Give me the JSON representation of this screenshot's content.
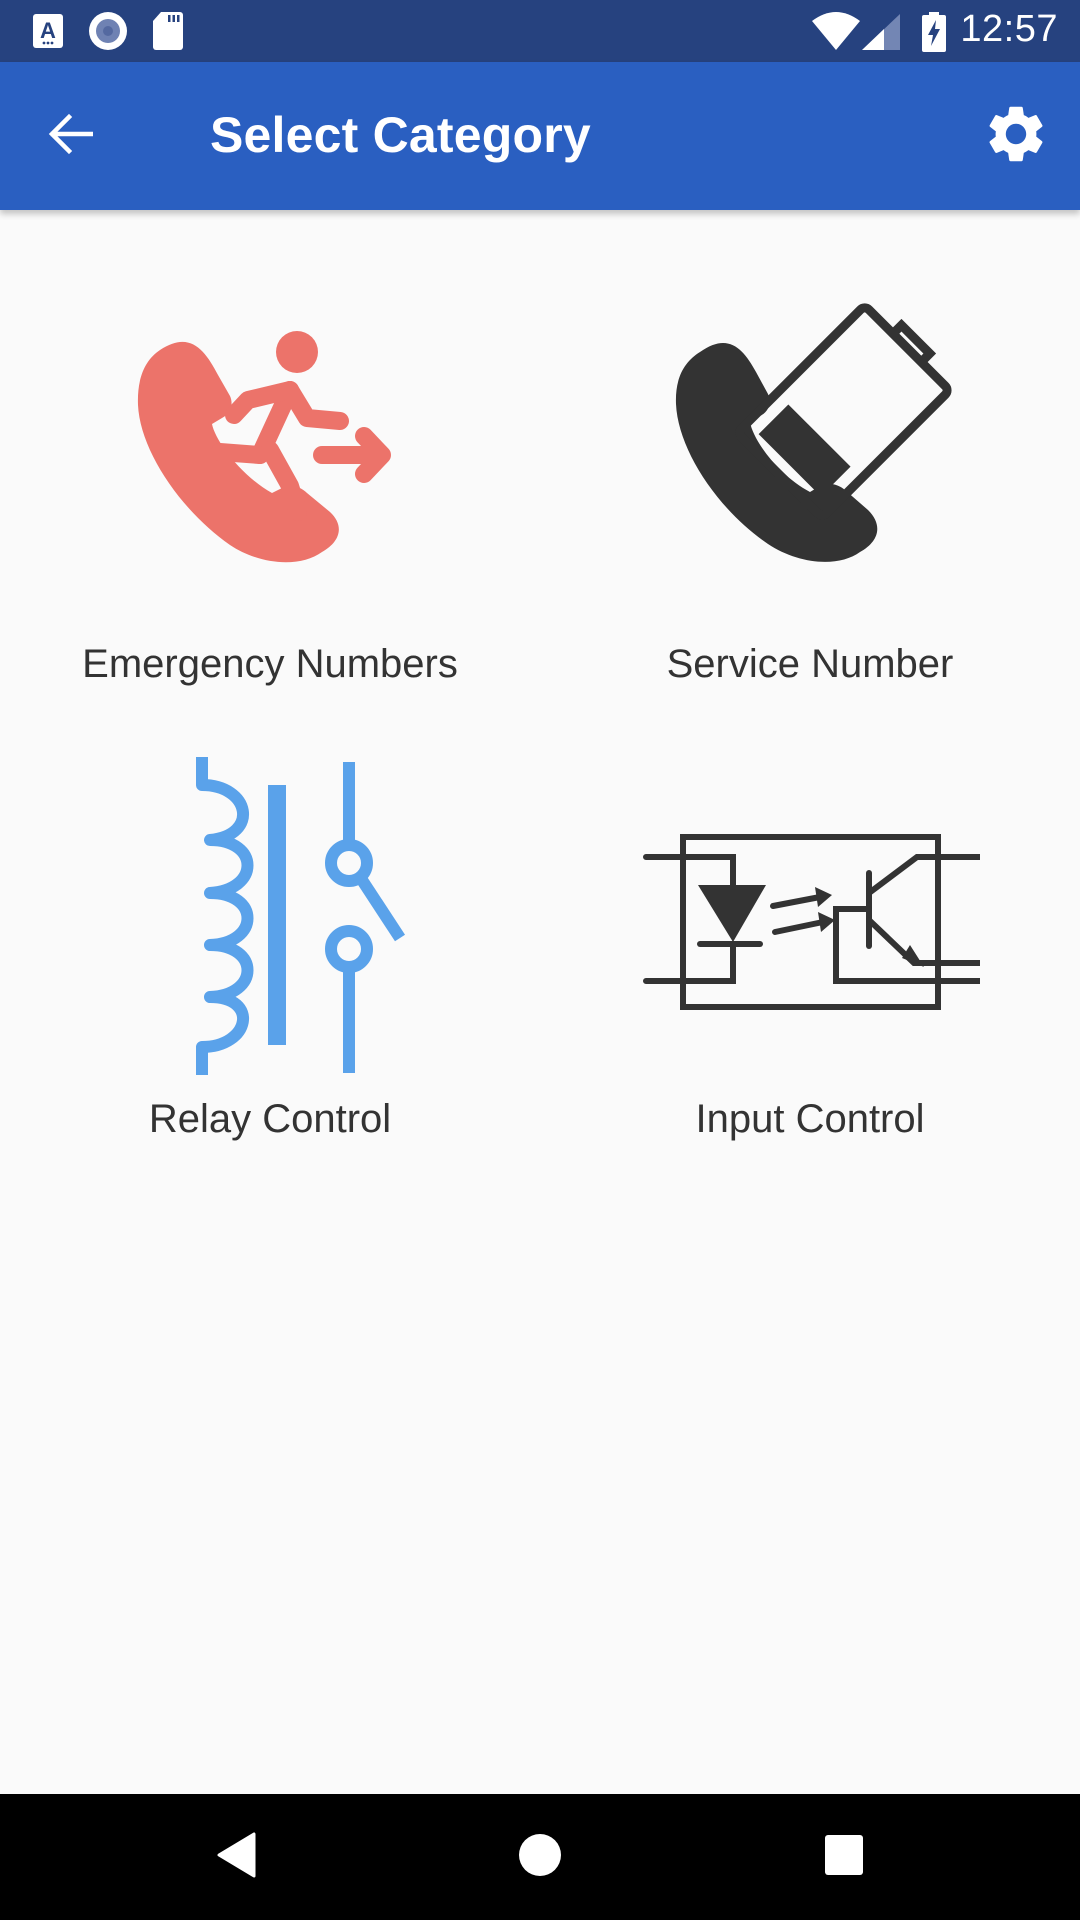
{
  "status_bar": {
    "time": "12:57",
    "left_icons": [
      "accessibility-a-icon",
      "record-circle-icon",
      "sd-card-icon"
    ],
    "right_icons": [
      "wifi-icon",
      "cellular-signal-icon",
      "battery-charging-icon"
    ],
    "background": "#26427f"
  },
  "app_bar": {
    "title": "Select Category",
    "back_icon": "arrow-back-icon",
    "settings_icon": "gear-icon",
    "background": "#2a5fc1"
  },
  "categories": [
    {
      "label": "Emergency Numbers",
      "icon": "emergency-exit-phone-icon",
      "color": "#ec736a"
    },
    {
      "label": "Service Number",
      "icon": "phone-battery-icon",
      "color": "#333333"
    },
    {
      "label": "Relay Control",
      "icon": "relay-symbol-icon",
      "color": "#5aa2ea"
    },
    {
      "label": "Input Control",
      "icon": "optocoupler-icon",
      "color": "#333333"
    }
  ],
  "nav_bar": {
    "buttons": [
      "back-triangle-icon",
      "home-circle-icon",
      "recents-square-icon"
    ]
  }
}
